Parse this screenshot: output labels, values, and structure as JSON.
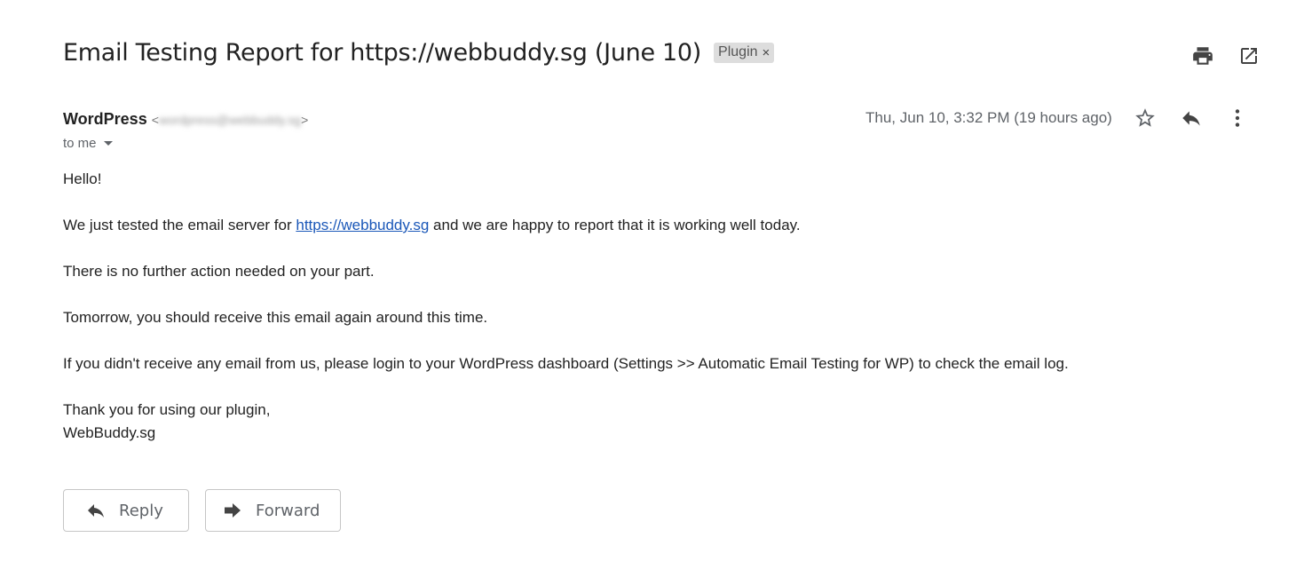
{
  "email": {
    "subject": "Email Testing Report for https://webbuddy.sg (June 10)",
    "label": "Plugin",
    "label_remove": "×",
    "sender_name": "WordPress",
    "sender_email_blurred": "wordpress@webbuddy.sg",
    "recipient": "to me",
    "date": "Thu, Jun 10, 3:32 PM (19 hours ago)"
  },
  "body": {
    "greeting": "Hello!",
    "line1_before": "We just tested the email server for ",
    "line1_link": "https://webbuddy.sg",
    "line1_after": " and we are happy to report that it is working well today.",
    "line2": "There is no further action needed on your part.",
    "line3": "Tomorrow, you should receive this email again around this time.",
    "line4": "If you didn't receive any email from us, please login to your WordPress dashboard (Settings >> Automatic Email Testing for WP) to check the email log.",
    "signoff": "Thank you for using our plugin,",
    "signature": "WebBuddy.sg"
  },
  "actions": {
    "reply_label": "Reply",
    "forward_label": "Forward"
  },
  "icons": {
    "print": "print-icon",
    "open_new_window": "open-in-new-window-icon",
    "star": "star-icon",
    "reply": "reply-icon",
    "more": "more-vertical-icon",
    "forward": "forward-icon"
  },
  "colors": {
    "link": "#1a57b8",
    "label_bg": "#dddddd",
    "icon": "#5f6368"
  }
}
